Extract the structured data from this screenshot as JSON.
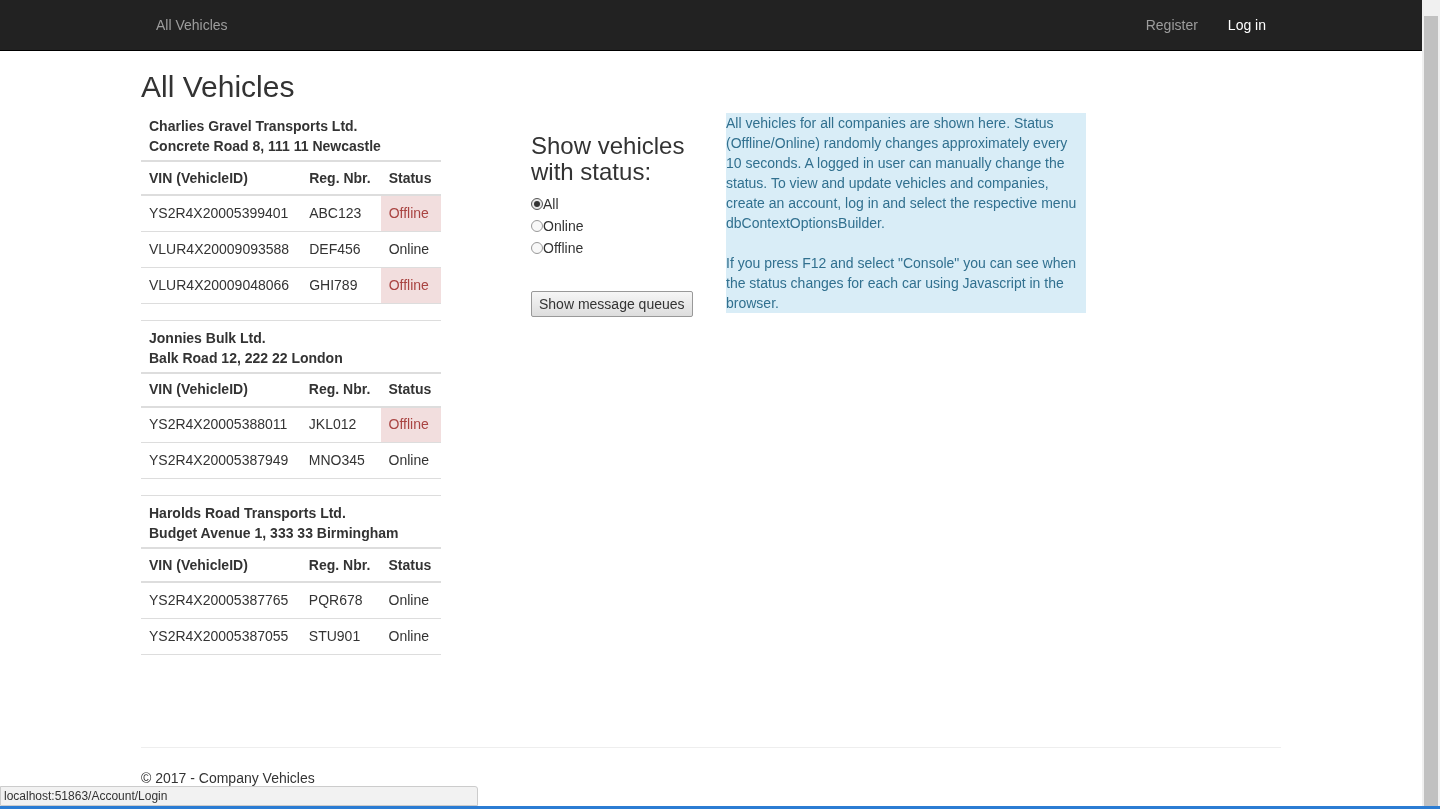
{
  "navbar": {
    "brand": "All Vehicles",
    "links": [
      {
        "label": "Register",
        "highlighted": false
      },
      {
        "label": "Log in",
        "highlighted": true
      }
    ]
  },
  "heading": "All Vehicles",
  "companies": [
    {
      "name": "Charlies Gravel Transports Ltd.",
      "address": "Concrete Road 8, 111 11 Newcastle",
      "columns": [
        "VIN (VehicleID)",
        "Reg. Nbr.",
        "Status"
      ],
      "rows": [
        {
          "vin": "YS2R4X20005399401",
          "reg": "ABC123",
          "status": "Offline",
          "offline": true
        },
        {
          "vin": "VLUR4X20009093588",
          "reg": "DEF456",
          "status": "Online",
          "offline": false
        },
        {
          "vin": "VLUR4X20009048066",
          "reg": "GHI789",
          "status": "Offline",
          "offline": true
        }
      ]
    },
    {
      "name": "Jonnies Bulk Ltd.",
      "address": "Balk Road 12, 222 22 London",
      "columns": [
        "VIN (VehicleID)",
        "Reg. Nbr.",
        "Status"
      ],
      "rows": [
        {
          "vin": "YS2R4X20005388011",
          "reg": "JKL012",
          "status": "Offline",
          "offline": true
        },
        {
          "vin": "YS2R4X20005387949",
          "reg": "MNO345",
          "status": "Online",
          "offline": false
        }
      ]
    },
    {
      "name": "Harolds Road Transports Ltd.",
      "address": "Budget Avenue 1, 333 33 Birmingham",
      "columns": [
        "VIN (VehicleID)",
        "Reg. Nbr.",
        "Status"
      ],
      "rows": [
        {
          "vin": "YS2R4X20005387765",
          "reg": "PQR678",
          "status": "Online",
          "offline": false
        },
        {
          "vin": "YS2R4X20005387055",
          "reg": "STU901",
          "status": "Online",
          "offline": false
        }
      ]
    }
  ],
  "filter": {
    "title": "Show vehicles with status:",
    "options": [
      {
        "label": "All",
        "selected": true
      },
      {
        "label": "Online",
        "selected": false
      },
      {
        "label": "Offline",
        "selected": false
      }
    ],
    "button": "Show message queues"
  },
  "info": {
    "paragraphs": [
      "All vehicles for all companies are shown here. Status (Offline/Online) randomly changes approximately every 10 seconds. A logged in user can manually change the status. To view and update vehicles and companies, create an account, log in and select the respective menu dbContextOptionsBuilder.",
      "If you press F12 and select \"Console\" you can see when the status changes for each car using Javascript in the browser."
    ]
  },
  "footer": "© 2017 - Company Vehicles",
  "status_bar": "localhost:51863/Account/Login"
}
